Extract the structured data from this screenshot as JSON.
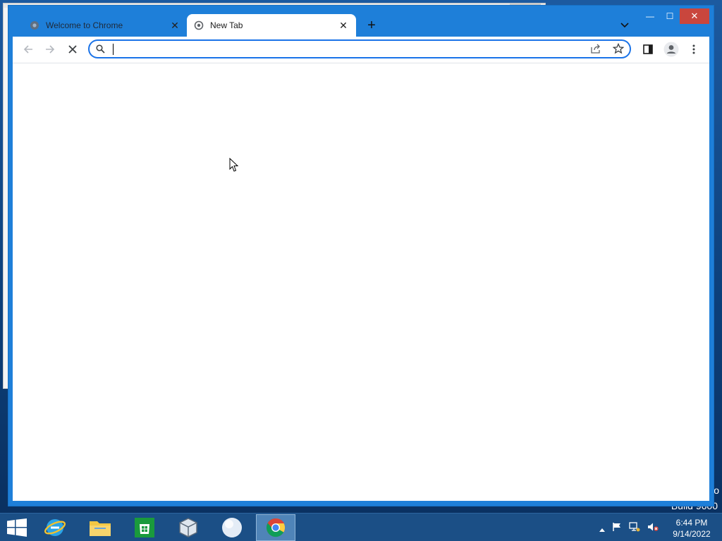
{
  "browser": {
    "tabs": [
      {
        "title": "Welcome to Chrome",
        "active": false
      },
      {
        "title": "New Tab",
        "active": true
      }
    ],
    "new_tab_symbol": "+",
    "window_controls": {
      "minimize": "—",
      "maximize": "☐",
      "close": "✕"
    },
    "omnibox": {
      "value": "",
      "placeholder": ""
    },
    "accent_color": "#1e7fd9"
  },
  "desktop": {
    "watermark": "Build 9600",
    "watermark_partial": "o"
  },
  "taskbar": {
    "pinned": [
      "internet-explorer-icon",
      "file-explorer-icon",
      "store-icon",
      "virtualbox-icon",
      "disc-icon",
      "chrome-icon"
    ],
    "clock_time": "6:44 PM",
    "clock_date": "9/14/2022"
  }
}
